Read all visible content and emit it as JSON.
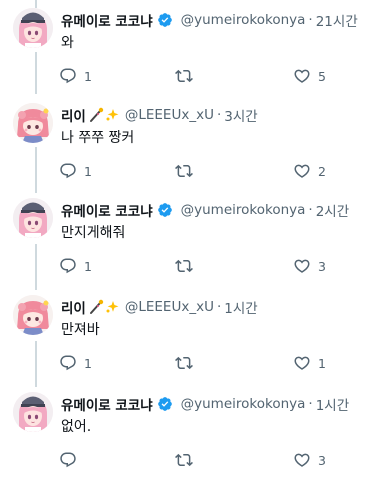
{
  "colors": {
    "text": "#0f1419",
    "muted": "#536471",
    "verified": "#1d9bf0",
    "thread_line": "#cfd9de"
  },
  "tweets": [
    {
      "name": "유메이로 코코냐",
      "verified": true,
      "emoji": "",
      "handle": "@yumeirokokonya",
      "sep": "·",
      "time": "21시간",
      "text": "와",
      "reply_count": "1",
      "retweet_count": "",
      "like_count": "5",
      "avatar": "kokonya-avatar"
    },
    {
      "name": "리이",
      "verified": false,
      "emoji": "wand-sparkle-emoji",
      "handle": "@LEEEUx_xU",
      "sep": "·",
      "time": "3시간",
      "text": "나 쭈쭈 짱커",
      "reply_count": "1",
      "retweet_count": "",
      "like_count": "2",
      "avatar": "riiyi-avatar"
    },
    {
      "name": "유메이로 코코냐",
      "verified": true,
      "emoji": "",
      "handle": "@yumeirokokonya",
      "sep": "·",
      "time": "2시간",
      "text": "만지게해줘",
      "reply_count": "1",
      "retweet_count": "",
      "like_count": "3",
      "avatar": "kokonya-avatar"
    },
    {
      "name": "리이",
      "verified": false,
      "emoji": "wand-sparkle-emoji",
      "handle": "@LEEEUx_xU",
      "sep": "·",
      "time": "1시간",
      "text": "만져바",
      "reply_count": "1",
      "retweet_count": "",
      "like_count": "1",
      "avatar": "riiyi-avatar"
    },
    {
      "name": "유메이로 코코냐",
      "verified": true,
      "emoji": "",
      "handle": "@yumeirokokonya",
      "sep": "·",
      "time": "1시간",
      "text": "없어.",
      "reply_count": "",
      "retweet_count": "",
      "like_count": "3",
      "avatar": "kokonya-avatar"
    }
  ]
}
